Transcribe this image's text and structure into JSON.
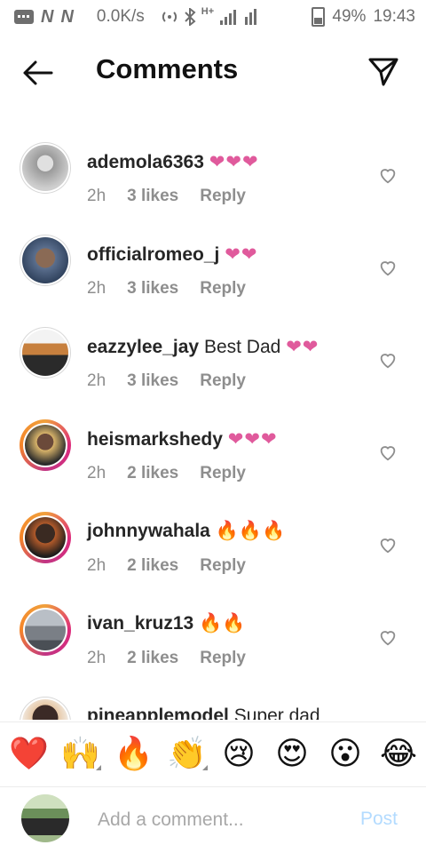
{
  "status_bar": {
    "carrier_marks": [
      "N",
      "N"
    ],
    "speed": "0.0K/s",
    "network": "H+",
    "battery": "49%",
    "time": "19:43"
  },
  "header": {
    "title": "Comments"
  },
  "comments": [
    {
      "username": "ademola6363",
      "text": "",
      "emoji": "❤❤❤",
      "emoji_type": "heart",
      "time": "2h",
      "likes": "3 likes",
      "reply": "Reply",
      "ring": false,
      "avatar_color": "#9a9a9a"
    },
    {
      "username": "officialromeo_j",
      "text": "",
      "emoji": "❤❤",
      "emoji_type": "heart",
      "time": "2h",
      "likes": "3 likes",
      "reply": "Reply",
      "ring": false,
      "avatar_color": "#5b6f8e"
    },
    {
      "username": "eazzylee_jay",
      "text": "Best Dad",
      "emoji": "❤❤",
      "emoji_type": "heart",
      "time": "2h",
      "likes": "3 likes",
      "reply": "Reply",
      "ring": false,
      "avatar_color": "#b98a5a"
    },
    {
      "username": "heismarkshedy",
      "text": "",
      "emoji": "❤❤❤",
      "emoji_type": "heart",
      "time": "2h",
      "likes": "2 likes",
      "reply": "Reply",
      "ring": true,
      "avatar_color": "#6b4a3a"
    },
    {
      "username": "johnnywahala",
      "text": "",
      "emoji": "🔥🔥🔥",
      "emoji_type": "fire",
      "time": "2h",
      "likes": "2 likes",
      "reply": "Reply",
      "ring": true,
      "avatar_color": "#3a2a22"
    },
    {
      "username": "ivan_kruz13",
      "text": "",
      "emoji": "🔥🔥",
      "emoji_type": "fire",
      "time": "2h",
      "likes": "2 likes",
      "reply": "Reply",
      "ring": true,
      "avatar_color": "#7a7f86"
    },
    {
      "username": "pineapplemodel",
      "text": "Super dad",
      "emoji": "",
      "emoji_type": "",
      "time": "",
      "likes": "",
      "reply": "",
      "ring": false,
      "avatar_color": "#3b2a26"
    }
  ],
  "emoji_bar": [
    "❤️",
    "🙌",
    "🔥",
    "👏",
    "😢",
    "😍",
    "😮",
    "😂"
  ],
  "composer": {
    "placeholder": "Add a comment...",
    "post_label": "Post",
    "post_color": "#b3dbff"
  }
}
